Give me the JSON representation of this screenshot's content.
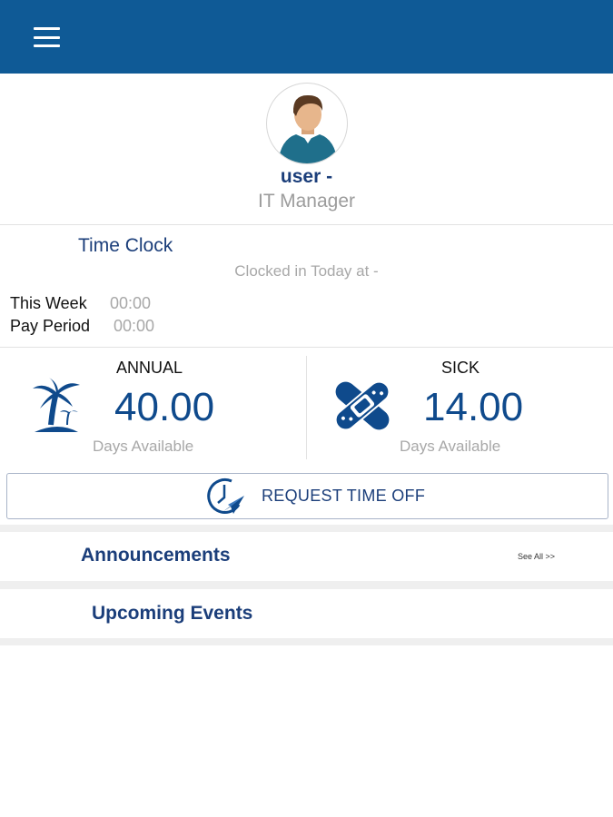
{
  "header": {
    "menu_icon": "hamburger-menu-icon",
    "bar_color": "#0f5a96"
  },
  "profile": {
    "name": "user -",
    "role": "IT Manager",
    "avatar_icon": "user-avatar-icon"
  },
  "time_clock": {
    "title": "Time Clock",
    "clocked_in": "Clocked in Today at -",
    "this_week_label": "This Week",
    "this_week_value": "00:00",
    "pay_period_label": "Pay Period",
    "pay_period_value": "00:00"
  },
  "leave": {
    "annual": {
      "label": "ANNUAL",
      "value": "40.00",
      "sub": "Days Available",
      "icon": "palm-tree-icon"
    },
    "sick": {
      "label": "SICK",
      "value": "14.00",
      "sub": "Days Available",
      "icon": "bandage-icon"
    }
  },
  "request_time_off": {
    "label": "REQUEST TIME OFF",
    "icon": "clock-plane-icon"
  },
  "announcements": {
    "title": "Announcements",
    "see_all": "See All >>"
  },
  "upcoming_events": {
    "title": "Upcoming Events"
  },
  "colors": {
    "accent": "#1b3e7a",
    "number": "#0f4a8c",
    "muted": "#a8a8a8"
  }
}
